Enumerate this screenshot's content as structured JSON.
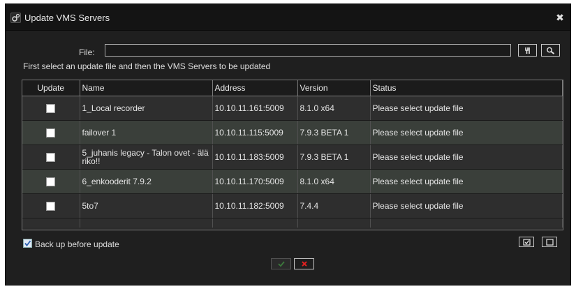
{
  "window": {
    "title": "Update VMS Servers",
    "close_glyph": "✖"
  },
  "file": {
    "label": "File:",
    "value": "",
    "placeholder": ""
  },
  "hint": "First select an update file and then the VMS Servers to be updated",
  "table": {
    "columns": [
      "Update",
      "Name",
      "Address",
      "Version",
      "Status"
    ],
    "rows": [
      {
        "checked": false,
        "name": "1_Local recorder",
        "address": "10.10.11.161:5009",
        "version": "8.1.0 x64",
        "status": "Please select update file"
      },
      {
        "checked": false,
        "name": "failover 1",
        "address": "10.10.11.115:5009",
        "version": "7.9.3 BETA 1",
        "status": "Please select update file"
      },
      {
        "checked": false,
        "name": "5_juhanis legacy - Talon ovet - älä riko!!",
        "address": "10.10.11.183:5009",
        "version": "7.9.3 BETA 1",
        "status": "Please select update file"
      },
      {
        "checked": false,
        "name": "6_enkooderit 7.9.2",
        "address": "10.10.11.170:5009",
        "version": "8.1.0 x64",
        "status": "Please select update file"
      },
      {
        "checked": false,
        "name": "5to7",
        "address": "10.10.11.182:5009",
        "version": "7.4.4",
        "status": "Please select update file"
      }
    ]
  },
  "backup": {
    "label": "Back up before update",
    "checked": true
  },
  "icons": {
    "title": "gear-icon",
    "browse": "tools-icon",
    "search": "magnifier-icon",
    "select_all": "checked-box-icon",
    "select_none": "empty-box-icon",
    "ok": "checkmark-icon",
    "cancel": "cross-icon"
  },
  "colors": {
    "background": "#1f1f1f",
    "titlebar": "#141414",
    "row_alt": "#3a3f3a",
    "cancel_red": "#e02020",
    "ok_green": "#3c7a3c"
  }
}
